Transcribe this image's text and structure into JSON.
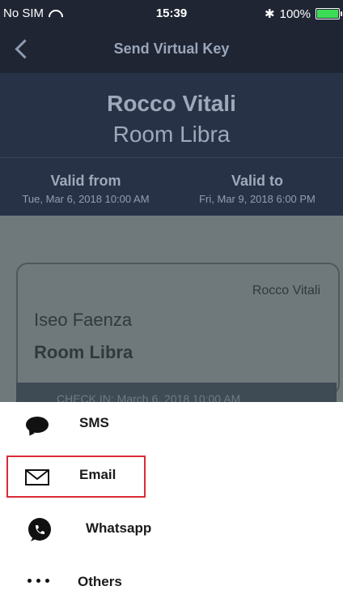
{
  "status_bar": {
    "carrier": "No SIM",
    "time": "15:39",
    "battery_text": "100%",
    "battery_level": 1.0
  },
  "nav": {
    "title": "Send Virtual Key",
    "back_icon": "chevron-left-icon"
  },
  "header": {
    "guest_name": "Rocco Vitali",
    "room_name": "Room Libra"
  },
  "validity": {
    "from_label": "Valid from",
    "from_value": "Tue, Mar 6, 2018 10:00 AM",
    "to_label": "Valid to",
    "to_value": "Fri, Mar 9, 2018 6:00 PM"
  },
  "card": {
    "guest": "Rocco Vitali",
    "hotel": "Iseo Faenza",
    "room": "Room Libra",
    "strip_text": "CHECK IN: March 6, 2018 10:00 AM"
  },
  "share_sheet": {
    "options": [
      {
        "label": "SMS",
        "icon": "sms-icon"
      },
      {
        "label": "Email",
        "icon": "mail-icon"
      },
      {
        "label": "Whatsapp",
        "icon": "whatsapp-icon"
      },
      {
        "label": "Others",
        "icon": "more-icon"
      }
    ]
  },
  "colors": {
    "status_bg": "#1f2533",
    "header_bg": "#273247",
    "highlight": "#d92c37"
  }
}
